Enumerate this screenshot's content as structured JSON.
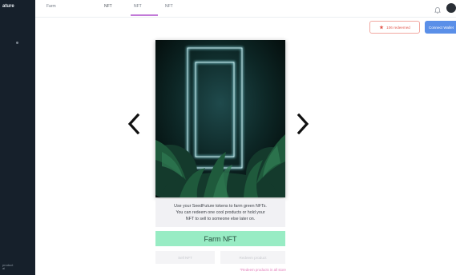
{
  "app": {
    "brand": "ature",
    "footer_line1": "product",
    "footer_line2": "ai"
  },
  "nav": {
    "items": [
      {
        "label": "Farm"
      },
      {
        "label": "NFT"
      },
      {
        "label": "NFT"
      },
      {
        "label": "NFT"
      }
    ],
    "active_index": 1
  },
  "header": {
    "redeemed_label": "106 redeemed",
    "connect_label": "Connect Wallet"
  },
  "icons": {
    "bell": "bell-icon",
    "star": "star-icon",
    "chevron_left": "chevron-left-icon",
    "chevron_right": "chevron-right-icon"
  },
  "card": {
    "description_lines": [
      "Use your SeedFuture tokens to farm green NFTs.",
      "You can redeem one cool products or hold your",
      "NFT to sell to someone else later on."
    ],
    "farm_label": "Farm NFT",
    "sell_label": "Sell NFT",
    "redeem_label": "Redeem product",
    "note": "*Redeem products in all store"
  },
  "colors": {
    "sidebar": "#16202b",
    "accent_pink": "#c27ad8",
    "farm_green": "#98ecc4",
    "connect_blue": "#5a8fe8",
    "redeemed_red": "#e25a4f"
  }
}
